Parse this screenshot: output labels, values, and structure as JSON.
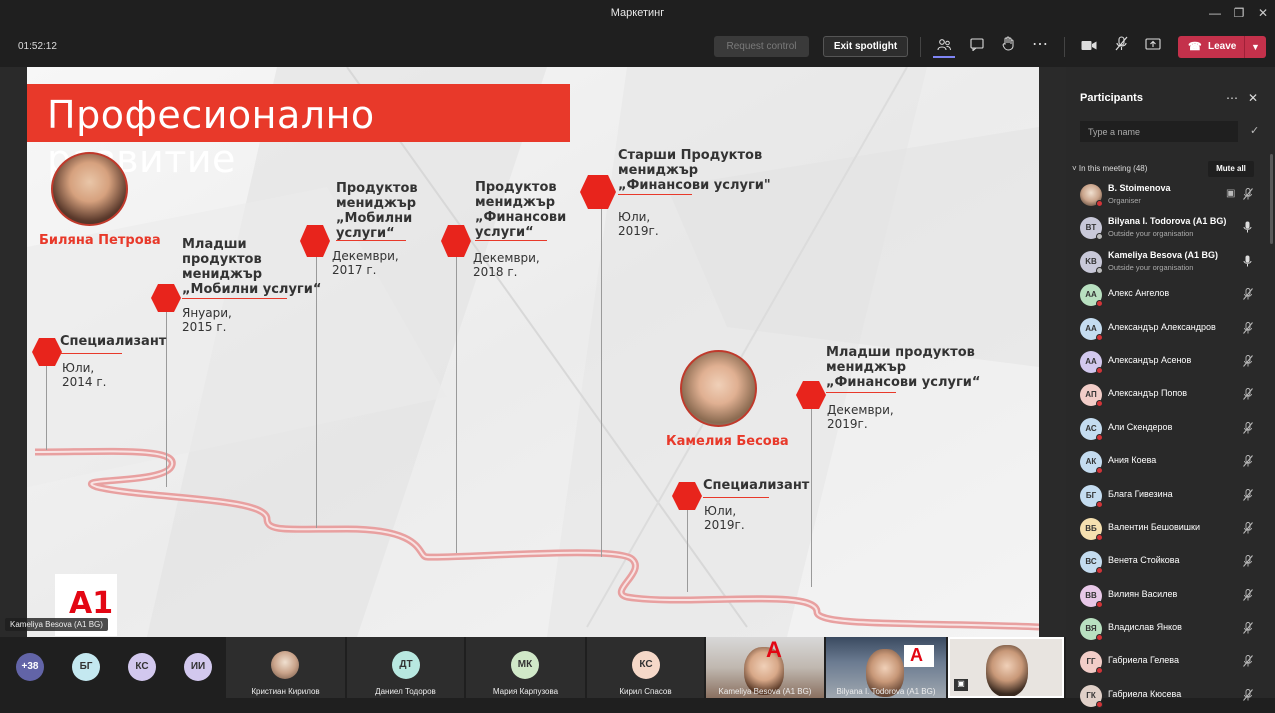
{
  "window": {
    "title": "Маркетинг"
  },
  "toolbar": {
    "timer": "01:52:12",
    "request_control": "Request control",
    "exit_spotlight": "Exit spotlight",
    "leave": "Leave"
  },
  "slide": {
    "title": "Професионално развитие",
    "person1": "Биляна Петрова",
    "person2": "Камелия Бесова",
    "logo": "A1",
    "milestones": [
      {
        "title_lines": [
          "Специализант"
        ],
        "date_lines": [
          "Юли,",
          "2014 г."
        ]
      },
      {
        "title_lines": [
          "Младши",
          "продуктов",
          "мениджър",
          "„Мобилни услуги“"
        ],
        "date_lines": [
          "Януари,",
          "2015 г."
        ]
      },
      {
        "title_lines": [
          "Продуктов",
          "мениджър",
          "„Мобилни",
          "услуги“"
        ],
        "date_lines": [
          "Декември,",
          "2017 г."
        ]
      },
      {
        "title_lines": [
          "Продуктов",
          "мениджър",
          "„Финансови",
          "услуги“"
        ],
        "date_lines": [
          "Декември,",
          "2018 г."
        ]
      },
      {
        "title_lines": [
          "Старши Продуктов",
          "мениджър",
          "„Финансови услуги\""
        ],
        "date_lines": [
          "Юли,",
          "2019г."
        ]
      },
      {
        "title_lines": [
          "Специализант"
        ],
        "date_lines": [
          "Юли,",
          "2019г."
        ]
      },
      {
        "title_lines": [
          "Младши продуктов",
          "мениджър",
          "„Финансови услуги“"
        ],
        "date_lines": [
          "Декември,",
          "2019г."
        ]
      }
    ]
  },
  "speaker_tag": "Kameliya Besova (A1 BG)",
  "panel": {
    "title": "Participants",
    "search_placeholder": "Type a name",
    "in_meeting": "In this meeting (48)",
    "mute_all": "Mute all",
    "participants": [
      {
        "initials": "",
        "name": "B. Stoimenova",
        "sub": "Organiser",
        "color": "#c9a38a",
        "photo": true
      },
      {
        "initials": "BT",
        "name": "Bilyana I. Todorova (A1 BG)",
        "sub": "Outside your organisation",
        "color": "#c8c8d8"
      },
      {
        "initials": "KB",
        "name": "Kameliya Besova (A1 BG)",
        "sub": "Outside your organisation",
        "color": "#c8c8d8"
      },
      {
        "initials": "AA",
        "name": "Алекс Ангелов",
        "sub": "",
        "color": "#b8e0c0"
      },
      {
        "initials": "AA",
        "name": "Александър Александров",
        "sub": "",
        "color": "#c4dcf0"
      },
      {
        "initials": "AA",
        "name": "Александър Асенов",
        "sub": "",
        "color": "#d2c8ee"
      },
      {
        "initials": "АП",
        "name": "Александър Попов",
        "sub": "",
        "color": "#f2cdc8"
      },
      {
        "initials": "АС",
        "name": "Али Скендеров",
        "sub": "",
        "color": "#c4dcf0"
      },
      {
        "initials": "АК",
        "name": "Ания Коева",
        "sub": "",
        "color": "#c4dcf0"
      },
      {
        "initials": "БГ",
        "name": "Блага Гивезина",
        "sub": "",
        "color": "#c4dcf0"
      },
      {
        "initials": "ВБ",
        "name": "Валентин Бешовишки",
        "sub": "",
        "color": "#f5e0b0"
      },
      {
        "initials": "ВС",
        "name": "Венета Стойкова",
        "sub": "",
        "color": "#c4dcf0"
      },
      {
        "initials": "ВВ",
        "name": "Вилиян Василев",
        "sub": "",
        "color": "#e8c8e8"
      },
      {
        "initials": "ВЯ",
        "name": "Владислав Янков",
        "sub": "",
        "color": "#b8e0c0"
      },
      {
        "initials": "ГГ",
        "name": "Габриела Гелева",
        "sub": "",
        "color": "#f2cdc8"
      },
      {
        "initials": "ГК",
        "name": "Габриела Кюсева",
        "sub": "",
        "color": "#e0d0c8"
      }
    ]
  },
  "bottom": {
    "more": "+38",
    "avatars": [
      {
        "initials": "БГ",
        "color": "#c4e8f0"
      },
      {
        "initials": "КС",
        "color": "#d2c8ee"
      },
      {
        "initials": "ИИ",
        "color": "#d2c8ee"
      }
    ],
    "tiles": [
      {
        "name": "Кристиан Кирилов",
        "initials": "",
        "color": "#c9a38a"
      },
      {
        "name": "Даниел Тодоров",
        "initials": "ДТ",
        "color": "#b8e8e0"
      },
      {
        "name": "Мария Карпузова",
        "initials": "МК",
        "color": "#d0e8c8"
      },
      {
        "name": "Кирил Спасов",
        "initials": "КС",
        "color": "#f5d8c8"
      }
    ],
    "video_tiles": [
      {
        "name": "Kameliya Besova (A1 BG)"
      },
      {
        "name": "Bilyana I. Todorova (A1 BG)"
      }
    ]
  }
}
